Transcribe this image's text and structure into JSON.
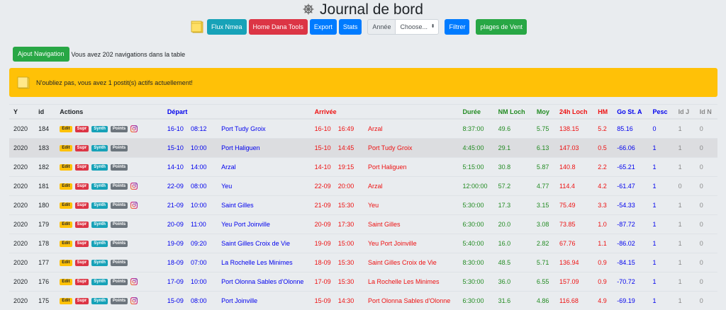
{
  "header": {
    "title": "Journal de bord"
  },
  "toolbar": {
    "flux_label": "Flux Nmea",
    "home_label": "Home Dana Tools",
    "export_label": "Export",
    "stats_label": "Stats",
    "annee_label": "Année",
    "annee_select": "Choose...",
    "filtrer_label": "Filtrer",
    "vent_label": "plages de Vent"
  },
  "nav": {
    "add_label": "Ajout Navigation",
    "count_text": "Vous avez 202 navigations dans la table"
  },
  "alert": {
    "text": "N'oubliez pas, vous avez 1 postit(s) actifs actuellement!"
  },
  "table": {
    "headers": {
      "y": "Y",
      "id": "id",
      "actions": "Actions",
      "depart": "Départ",
      "arrivee": "Arrivée",
      "duree": "Durée",
      "nm_loch": "NM Loch",
      "moy": "Moy",
      "h24_loch": "24h Loch",
      "hm": "HM",
      "go": "Go St. A",
      "pesc": "Pesc",
      "idj": "Id J",
      "idn": "Id N"
    },
    "badges": {
      "edit": "Edit",
      "supr": "Supr",
      "synth": "Synth",
      "points": "Points"
    },
    "rows": [
      {
        "y": "2020",
        "id": "184",
        "insta": true,
        "dep_date": "16-10",
        "dep_time": "08:12",
        "dep_place": "Port Tudy Groix",
        "arr_date": "16-10",
        "arr_time": "16:49",
        "arr_place": "Arzal",
        "duree": "8:37:00",
        "nm": "49.6",
        "moy": "5.75",
        "h24": "138.15",
        "hm": "5.2",
        "go": "85.16",
        "pesc": "0",
        "idj": "1",
        "idn": "0"
      },
      {
        "y": "2020",
        "id": "183",
        "insta": false,
        "dep_date": "15-10",
        "dep_time": "10:00",
        "dep_place": "Port Haliguen",
        "arr_date": "15-10",
        "arr_time": "14:45",
        "arr_place": "Port Tudy Groix",
        "duree": "4:45:00",
        "nm": "29.1",
        "moy": "6.13",
        "h24": "147.03",
        "hm": "0.5",
        "go": "-66.06",
        "pesc": "1",
        "idj": "1",
        "idn": "0"
      },
      {
        "y": "2020",
        "id": "182",
        "insta": false,
        "dep_date": "14-10",
        "dep_time": "14:00",
        "dep_place": "Arzal",
        "arr_date": "14-10",
        "arr_time": "19:15",
        "arr_place": "Port Haliguen",
        "duree": "5:15:00",
        "nm": "30.8",
        "moy": "5.87",
        "h24": "140.8",
        "hm": "2.2",
        "go": "-65.21",
        "pesc": "1",
        "idj": "1",
        "idn": "0"
      },
      {
        "y": "2020",
        "id": "181",
        "insta": true,
        "dep_date": "22-09",
        "dep_time": "08:00",
        "dep_place": "Yeu",
        "arr_date": "22-09",
        "arr_time": "20:00",
        "arr_place": "Arzal",
        "duree": "12:00:00",
        "nm": "57.2",
        "moy": "4.77",
        "h24": "114.4",
        "hm": "4.2",
        "go": "-61.47",
        "pesc": "1",
        "idj": "0",
        "idn": "0"
      },
      {
        "y": "2020",
        "id": "180",
        "insta": true,
        "dep_date": "21-09",
        "dep_time": "10:00",
        "dep_place": "Saint Gilles",
        "arr_date": "21-09",
        "arr_time": "15:30",
        "arr_place": "Yeu",
        "duree": "5:30:00",
        "nm": "17.3",
        "moy": "3.15",
        "h24": "75.49",
        "hm": "3.3",
        "go": "-54.33",
        "pesc": "1",
        "idj": "1",
        "idn": "0"
      },
      {
        "y": "2020",
        "id": "179",
        "insta": false,
        "dep_date": "20-09",
        "dep_time": "11:00",
        "dep_place": "Yeu Port Joinville",
        "arr_date": "20-09",
        "arr_time": "17:30",
        "arr_place": "Saint Gilles",
        "duree": "6:30:00",
        "nm": "20.0",
        "moy": "3.08",
        "h24": "73.85",
        "hm": "1.0",
        "go": "-87.72",
        "pesc": "1",
        "idj": "1",
        "idn": "0"
      },
      {
        "y": "2020",
        "id": "178",
        "insta": false,
        "dep_date": "19-09",
        "dep_time": "09:20",
        "dep_place": "Saint Gilles Croix de Vie",
        "arr_date": "19-09",
        "arr_time": "15:00",
        "arr_place": "Yeu Port Joinville",
        "duree": "5:40:00",
        "nm": "16.0",
        "moy": "2.82",
        "h24": "67.76",
        "hm": "1.1",
        "go": "-86.02",
        "pesc": "1",
        "idj": "1",
        "idn": "0"
      },
      {
        "y": "2020",
        "id": "177",
        "insta": false,
        "dep_date": "18-09",
        "dep_time": "07:00",
        "dep_place": "La Rochelle Les Minimes",
        "arr_date": "18-09",
        "arr_time": "15:30",
        "arr_place": "Saint Gilles Croix de Vie",
        "duree": "8:30:00",
        "nm": "48.5",
        "moy": "5.71",
        "h24": "136.94",
        "hm": "0.9",
        "go": "-84.15",
        "pesc": "1",
        "idj": "1",
        "idn": "0"
      },
      {
        "y": "2020",
        "id": "176",
        "insta": true,
        "dep_date": "17-09",
        "dep_time": "10:00",
        "dep_place": "Port Olonna Sables d'Olonne",
        "arr_date": "17-09",
        "arr_time": "15:30",
        "arr_place": "La Rochelle Les Minimes",
        "duree": "5:30:00",
        "nm": "36.0",
        "moy": "6.55",
        "h24": "157.09",
        "hm": "0.9",
        "go": "-70.72",
        "pesc": "1",
        "idj": "1",
        "idn": "0"
      },
      {
        "y": "2020",
        "id": "175",
        "insta": true,
        "dep_date": "15-09",
        "dep_time": "08:00",
        "dep_place": "Port Joinville",
        "arr_date": "15-09",
        "arr_time": "14:30",
        "arr_place": "Port Olonna Sables d'Olonne",
        "duree": "6:30:00",
        "nm": "31.6",
        "moy": "4.86",
        "h24": "116.68",
        "hm": "4.9",
        "go": "-69.19",
        "pesc": "1",
        "idj": "1",
        "idn": "0"
      }
    ]
  },
  "colors": {
    "warning": "#ffc107",
    "danger": "#dc3545",
    "info": "#17a2b8",
    "primary": "#007bff",
    "success": "#28a745",
    "secondary": "#6c757d"
  }
}
